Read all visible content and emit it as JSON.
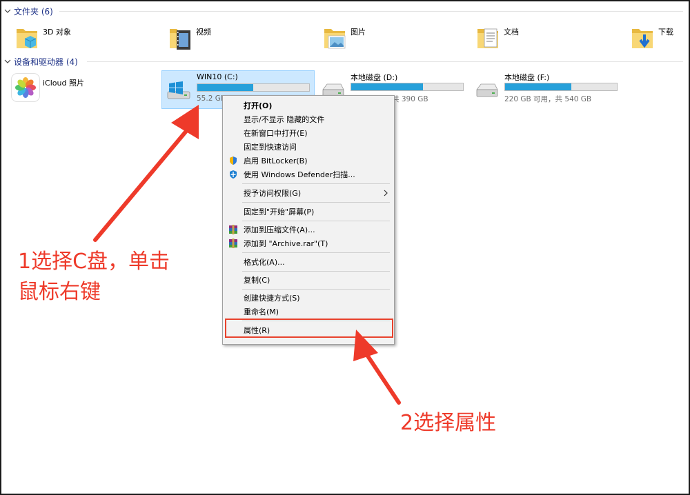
{
  "sections": {
    "folders_header": "文件夹 (6)",
    "devices_header": "设备和驱动器 (4)"
  },
  "folders": [
    {
      "name": "3D 对象",
      "icon": "3d-objects-folder-icon"
    },
    {
      "name": "视频",
      "icon": "videos-folder-icon"
    },
    {
      "name": "图片",
      "icon": "pictures-folder-icon"
    },
    {
      "name": "文档",
      "icon": "documents-folder-icon"
    },
    {
      "name": "下载",
      "icon": "downloads-folder-icon"
    }
  ],
  "icloud": {
    "name": "iCloud 照片",
    "icon": "icloud-photos-icon"
  },
  "drives": [
    {
      "name": "WIN10 (C:)",
      "size_text": "55.2 GB",
      "used_fraction": 0.5,
      "selected": true
    },
    {
      "name": "本地磁盘 (D:)",
      "size_text": "共 390 GB",
      "used_fraction": 0.64,
      "selected": false
    },
    {
      "name": "本地磁盘 (F:)",
      "size_text": "220 GB 可用，共 540 GB",
      "used_fraction": 0.59,
      "selected": false
    }
  ],
  "context_menu": {
    "items": {
      "open": "打开(O)",
      "show_hide": "显示/不显示 隐藏的文件",
      "open_new_window": "在新窗口中打开(E)",
      "pin_quick_access": "固定到快速访问",
      "bitlocker": "启用 BitLocker(B)",
      "defender": "使用 Windows Defender扫描...",
      "grant_access": "授予访问权限(G)",
      "pin_start": "固定到\"开始\"屏幕(P)",
      "add_archive": "添加到压缩文件(A)...",
      "add_archive_rar": "添加到 \"Archive.rar\"(T)",
      "format": "格式化(A)...",
      "copy": "复制(C)",
      "create_shortcut": "创建快捷方式(S)",
      "rename": "重命名(M)",
      "properties": "属性(R)"
    }
  },
  "annotations": {
    "step1_line1": "1选择C盘，单击",
    "step1_line2": "鼠标右键",
    "step2": "2选择属性"
  },
  "colors": {
    "selection_bg": "#cce8ff",
    "progress_fill": "#26a0da",
    "annotation_red": "#ee3a2a",
    "section_header_text": "#1e3287"
  }
}
